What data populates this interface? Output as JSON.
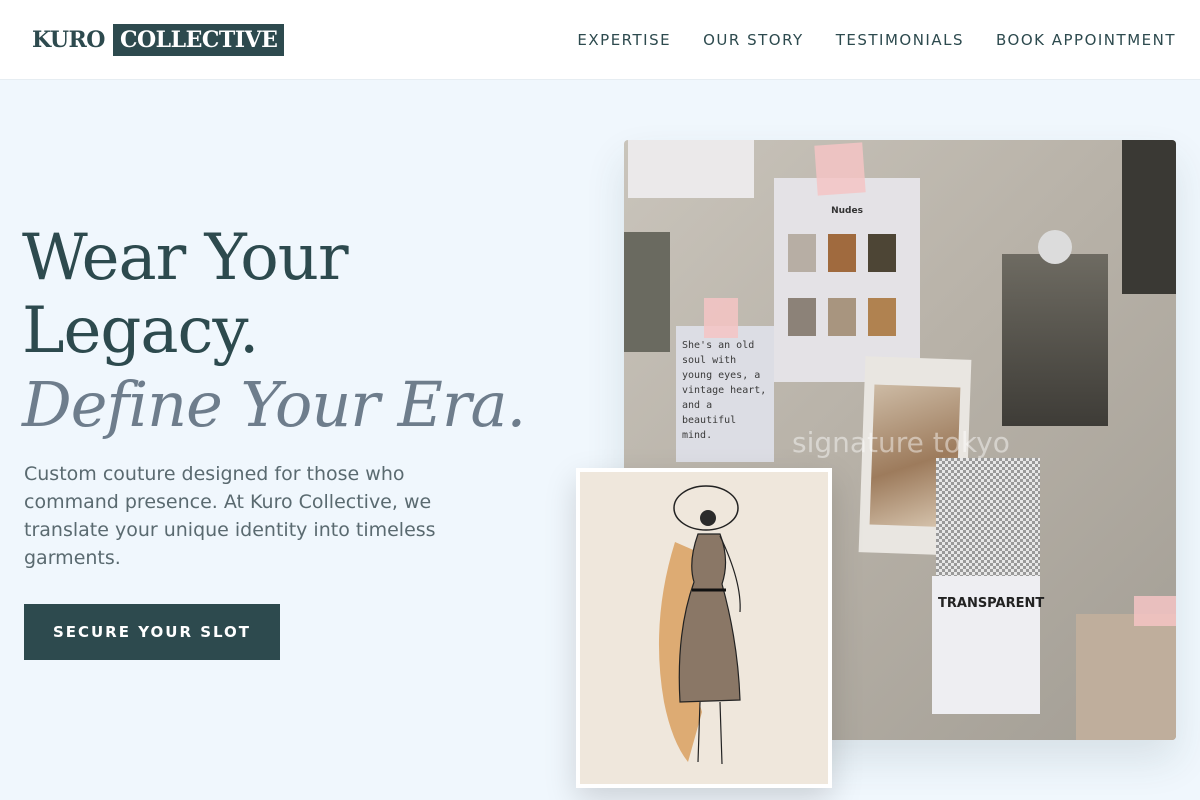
{
  "brand": {
    "logo_part1": "KURO",
    "logo_part2": "COLLECTIVE",
    "color_primary": "#2d4a4e",
    "color_bg": "#f0f7fd"
  },
  "nav": {
    "items": [
      {
        "label": "EXPERTISE"
      },
      {
        "label": "OUR STORY"
      },
      {
        "label": "TESTIMONIALS"
      },
      {
        "label": "BOOK APPOINTMENT"
      }
    ]
  },
  "hero": {
    "title_line1": "Wear Your",
    "title_line2": "Legacy.",
    "title_line3": "Define Your Era.",
    "subtitle": "Custom couture designed for those who command presence. At Kuro Collective, we translate your unique identity into timeless garments.",
    "cta_label": "SECURE YOUR SLOT"
  },
  "moodboard": {
    "swatch_card_title": "Nudes",
    "note_text": "She's an old soul with young eyes, a vintage heart, and a beautiful mind.",
    "label_card_title": "TRANSPARENT",
    "watermark": "signature tokyo",
    "icons": [
      "moodboard-photo",
      "fashion-sketch-photo"
    ]
  }
}
